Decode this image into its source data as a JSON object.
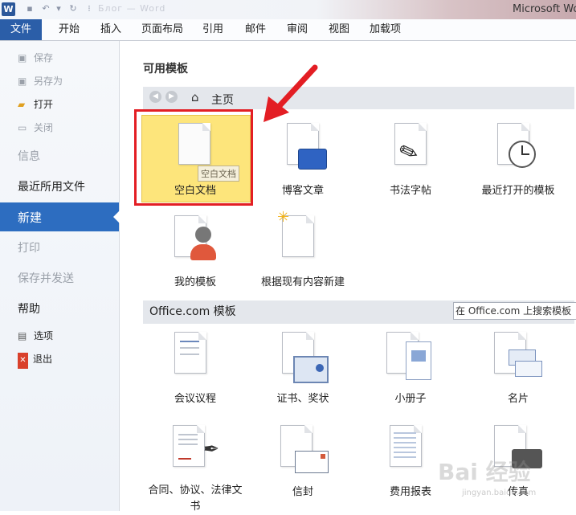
{
  "window": {
    "app_title": "Microsoft Wo",
    "doc_title": "Блог — Word",
    "app_icon_letter": "W"
  },
  "ribbon": {
    "file_tab": "文件",
    "tabs": [
      "开始",
      "插入",
      "页面布局",
      "引用",
      "邮件",
      "审阅",
      "视图",
      "加载项"
    ]
  },
  "backstage": {
    "save": "保存",
    "save_as": "另存为",
    "open": "打开",
    "close": "关闭",
    "info": "信息",
    "recent": "最近所用文件",
    "new": "新建",
    "print": "打印",
    "save_send": "保存并发送",
    "help": "帮助",
    "options": "选项",
    "exit": "退出"
  },
  "templates": {
    "section_title": "可用模板",
    "nav_home": "主页",
    "tooltip": "空白文档",
    "available": [
      {
        "label": "空白文档"
      },
      {
        "label": "博客文章"
      },
      {
        "label": "书法字帖"
      },
      {
        "label": "最近打开的模板"
      },
      {
        "label": "我的模板"
      },
      {
        "label": "根据现有内容新建"
      }
    ]
  },
  "office": {
    "section_title": "Office.com 模板",
    "search_placeholder": "在 Office.com 上搜索模板",
    "items": [
      {
        "label": "会议议程"
      },
      {
        "label": "证书、奖状"
      },
      {
        "label": "小册子"
      },
      {
        "label": "名片"
      },
      {
        "label": "合同、协议、法律文书"
      },
      {
        "label": "信封"
      },
      {
        "label": "费用报表"
      },
      {
        "label": "传真"
      }
    ]
  },
  "watermark": {
    "text": "Bai 经验",
    "sub": "jingyan.baidu.com"
  },
  "colors": {
    "file_tab": "#2b5ea8",
    "selected_item": "#2d6dc0",
    "highlight": "#fde57b",
    "annotation_red": "#e31e24"
  }
}
